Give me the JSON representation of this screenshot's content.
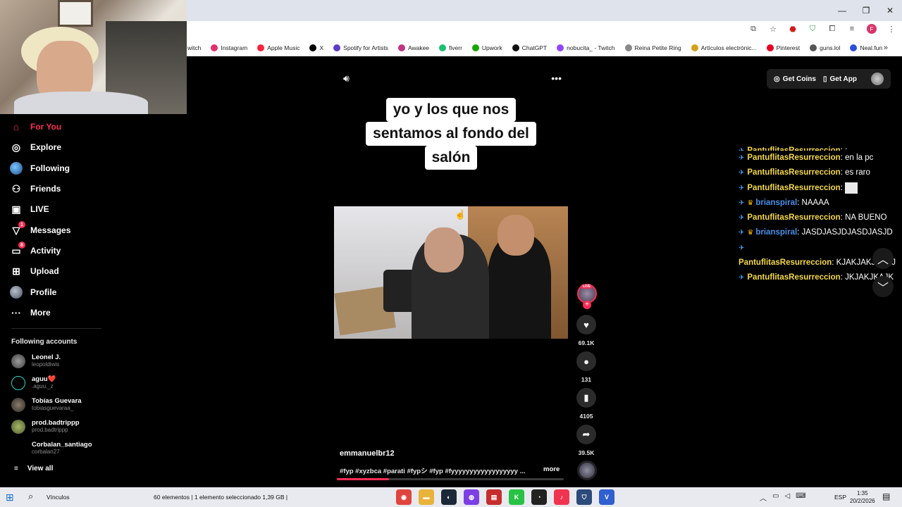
{
  "browser": {
    "bookmarks": [
      "witch",
      "Instagram",
      "Apple Music",
      "X",
      "Spotify for Artists",
      "Awakee",
      "fiverr",
      "Upwork",
      "ChatGPT",
      "nobucita_ - Twitch",
      "Reina Petite Ring",
      "Artículos electrónic...",
      "Pinterest",
      "guns.lol",
      "Neal.fun"
    ],
    "bookmark_colors": [
      "#9146ff",
      "#e1306c",
      "#fa233b",
      "#000000",
      "#5b3cc4",
      "#c13584",
      "#1dbf73",
      "#14a800",
      "#111111",
      "#9146ff",
      "#888888",
      "#d4a017",
      "#e60023",
      "#555555",
      "#2b4fd8"
    ],
    "profile_initial": "F"
  },
  "sidebar": {
    "nav": [
      {
        "label": "For You",
        "icon": "home-icon",
        "glyph": "⌂"
      },
      {
        "label": "Explore",
        "icon": "compass-icon",
        "glyph": "◎"
      },
      {
        "label": "Following",
        "icon": "following-avatar-icon",
        "glyph": ""
      },
      {
        "label": "Friends",
        "icon": "friends-icon",
        "glyph": "⚇"
      },
      {
        "label": "LIVE",
        "icon": "live-icon",
        "glyph": "▣"
      },
      {
        "label": "Messages",
        "icon": "messages-icon",
        "glyph": "▽",
        "badge": "1"
      },
      {
        "label": "Activity",
        "icon": "activity-icon",
        "glyph": "▭",
        "badge": "8"
      },
      {
        "label": "Upload",
        "icon": "upload-icon",
        "glyph": "⊞"
      },
      {
        "label": "Profile",
        "icon": "profile-icon",
        "glyph": ""
      },
      {
        "label": "More",
        "icon": "more-icon",
        "glyph": "···"
      }
    ],
    "following_title": "Following accounts",
    "accounts": [
      {
        "name": "Leonel J.",
        "handle": "leopoldiwis"
      },
      {
        "name": "aguu❤️",
        "handle": ".aguu._z"
      },
      {
        "name": "Tobías Guevara",
        "handle": "tobiasguevaraa_"
      },
      {
        "name": "prod.badtrippp",
        "handle": "prod.badtrippp"
      },
      {
        "name": "Corbalan_santiago",
        "handle": "corbalan27"
      }
    ],
    "view_all": "View all"
  },
  "video": {
    "caption_lines": [
      "yo y los que nos",
      "sentamos al fondo del",
      "salón"
    ],
    "author": "emmanuelbr12",
    "description": "#fyp #xyzbca #parati #fypシ #fyp #fyyyyyyyyyyyyyyyyyy ...",
    "more": "more",
    "progress_fraction": 0.23
  },
  "actions": {
    "live_tag": "LIVE",
    "likes": "69.1K",
    "comments": "131",
    "saves": "4105",
    "shares": "39.5K"
  },
  "header": {
    "get_coins": "Get Coins",
    "get_app": "Get App"
  },
  "chat": {
    "messages": [
      {
        "user": "PantuflitasResurreccion",
        "text": ": :",
        "color": "yellow",
        "crown": false,
        "cut": true
      },
      {
        "user": "PantuflitasResurreccion",
        "text": ": en la pc",
        "color": "yellow",
        "crown": false
      },
      {
        "user": "PantuflitasResurreccion",
        "text": ": es raro",
        "color": "yellow",
        "crown": false
      },
      {
        "user": "PantuflitasResurreccion",
        "text": ":",
        "color": "yellow",
        "crown": false,
        "emote": true
      },
      {
        "user": "brianspiral",
        "text": ": NAAAA",
        "color": "blue",
        "crown": true
      },
      {
        "user": "PantuflitasResurreccion",
        "text": ": NA BUENO",
        "color": "yellow",
        "crown": false
      },
      {
        "user": "brianspiral",
        "text": ": JASDJASJDJASDJASJD",
        "color": "blue",
        "crown": true
      },
      {
        "user": "PantuflitasResurreccion",
        "text": ": KJAKJAKJAKAJ",
        "color": "yellow",
        "crown": false,
        "wrap": true
      },
      {
        "user": "PantuflitasResurreccion",
        "text": ": JKJAKJKAJK",
        "color": "yellow",
        "crown": false
      }
    ]
  },
  "taskbar": {
    "vinculos": "Vínculos",
    "explorer_status": "60 elementos  |  1 elemento seleccionado  1,39 GB  |",
    "lang": "ESP",
    "time": "1:35",
    "date": "20/2/2026"
  }
}
